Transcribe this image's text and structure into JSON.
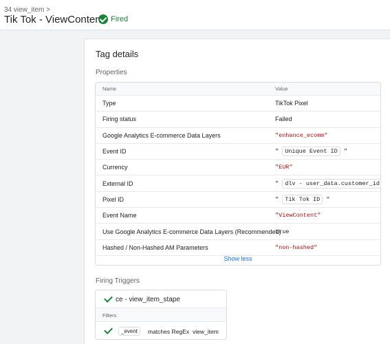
{
  "header": {
    "breadcrumb": "34 view_item >",
    "title": "Tik Tok - ViewContent",
    "status": "Fired"
  },
  "card": {
    "title": "Tag details",
    "properties_title": "Properties",
    "col_name": "Name",
    "col_value": "Value",
    "rows": [
      {
        "name": "Type",
        "value": "TikTok Pixel"
      },
      {
        "name": "Firing status",
        "value": "Failed"
      },
      {
        "name": "Google Analytics E-commerce Data Layers",
        "value": "\"enhance_ecomm\""
      },
      {
        "name": "Event ID",
        "value_prefix": "\"",
        "value_chip": "Unique Event ID",
        "value_suffix": "\""
      },
      {
        "name": "Currency",
        "value": "\"EUR\""
      },
      {
        "name": "External ID",
        "value_prefix": "\"",
        "value_chip": "dlv - user_data.customer_id",
        "value_suffix": "\""
      },
      {
        "name": "Pixel ID",
        "value_prefix": "\"",
        "value_chip": "Tik Tok ID",
        "value_suffix": "\""
      },
      {
        "name": "Event Name",
        "value": "\"ViewContent\""
      },
      {
        "name": "Use Google Analytics E-commerce Data Layers (Recommended)",
        "value": "true"
      },
      {
        "name": "Hashed / Non-Hashed AM Parameters",
        "value": "\"non-hashed\""
      }
    ],
    "show_less": "Show less",
    "triggers_title": "Firing Triggers",
    "trigger": {
      "name": "ce - view_item_stape",
      "filters_label": "Filters",
      "filter": {
        "variable": "_event",
        "operator": "matches RegEx",
        "value": "view_item"
      }
    }
  },
  "colors": {
    "success": "#188038",
    "link": "#1a73e8",
    "string": "#a50e0e"
  }
}
